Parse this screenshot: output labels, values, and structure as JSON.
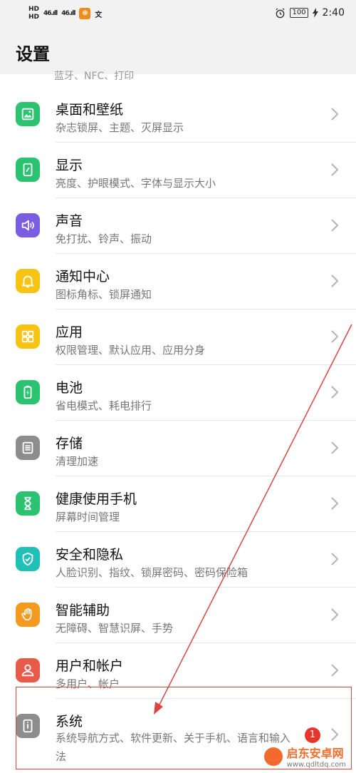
{
  "status_bar": {
    "hd_top": "HD",
    "hd_bottom": "HD",
    "signal1": "46.ıll",
    "signal2": "46.ıll",
    "app_glyph": "⊛",
    "chat_glyph": "文",
    "battery": "100",
    "time": "2:40",
    "icons": [
      "alarm-icon",
      "battery-icon",
      "charging-icon"
    ]
  },
  "header": {
    "title": "设置",
    "peek_text": "蓝牙、NFC、打印"
  },
  "items": [
    {
      "label": "桌面和壁纸",
      "sub": "杂志锁屏、主题、灭屏显示",
      "color": "#2bc36f",
      "icon": "wallpaper-icon"
    },
    {
      "label": "显示",
      "sub": "亮度、护眼模式、字体与显示大小",
      "color": "#2bc36f",
      "icon": "display-icon"
    },
    {
      "label": "声音",
      "sub": "免打扰、铃声、振动",
      "color": "#7a5de0",
      "icon": "sound-icon"
    },
    {
      "label": "通知中心",
      "sub": "图标角标、锁屏通知",
      "color": "#f7c413",
      "icon": "bell-icon"
    },
    {
      "label": "应用",
      "sub": "权限管理、默认应用、应用分身",
      "color": "#f7c413",
      "icon": "apps-icon"
    },
    {
      "label": "电池",
      "sub": "省电模式、耗电排行",
      "color": "#2bc36f",
      "icon": "battery-icon"
    },
    {
      "label": "存储",
      "sub": "清理加速",
      "color": "#8d8d8d",
      "icon": "storage-icon"
    },
    {
      "label": "健康使用手机",
      "sub": "屏幕时间管理",
      "color": "#2bc36f",
      "icon": "hourglass-icon"
    },
    {
      "label": "安全和隐私",
      "sub": "人脸识别、指纹、锁屏密码、密码保险箱",
      "color": "#1fc0b8",
      "icon": "shield-icon"
    },
    {
      "label": "智能辅助",
      "sub": "无障碍、智慧识屏、手势",
      "color": "#f39a1f",
      "icon": "hand-icon"
    },
    {
      "label": "用户和帐户",
      "sub": "多用户、帐户",
      "color": "#e85b4b",
      "icon": "user-icon"
    },
    {
      "label": "系统",
      "sub": "系统导航方式、软件更新、关于手机、语言和输入法",
      "color": "#8d8d8d",
      "icon": "system-info-icon",
      "badge": "1"
    }
  ],
  "watermark": {
    "line1": "启东安卓网",
    "line2": "www.qdltdq.com"
  },
  "colors": {
    "background": "#ffffff",
    "header_bg": "#f2f2f2",
    "annotation": "#d44444",
    "badge": "#e8352c"
  }
}
